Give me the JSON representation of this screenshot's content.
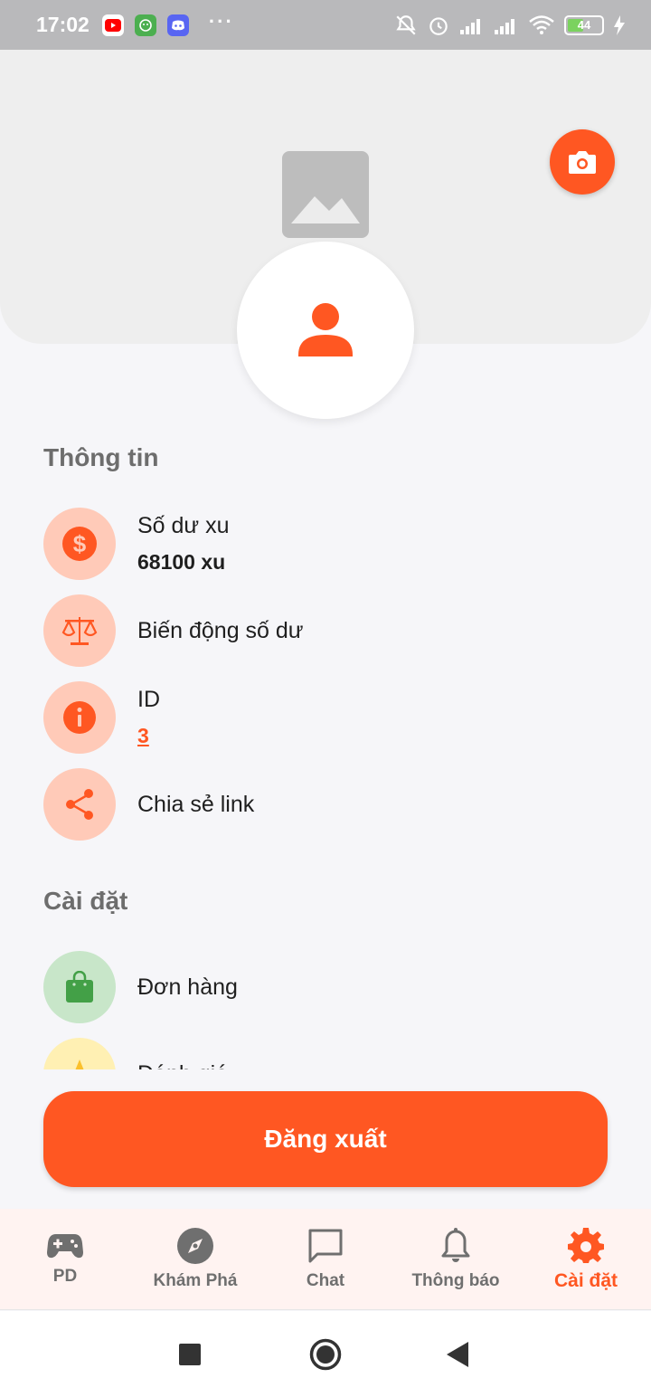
{
  "status_bar": {
    "time": "17:02",
    "battery": "44",
    "icons": [
      "youtube-icon",
      "app-icon",
      "discord-icon",
      "more-dots-icon",
      "mute-icon",
      "alarm-icon",
      "signal-icon",
      "signal-icon",
      "wifi-icon",
      "battery-icon",
      "charging-icon"
    ],
    "dots": "···"
  },
  "sections": {
    "info_title": "Thông tin",
    "settings_title": "Cài đặt"
  },
  "info_items": [
    {
      "label": "Số dư xu",
      "value": "68100 xu",
      "icon": "dollar-icon"
    },
    {
      "label": "Biến động số dư",
      "icon": "balance-scale-icon"
    },
    {
      "label": "ID",
      "value": "3",
      "icon": "info-icon"
    },
    {
      "label": "Chia sẻ link",
      "icon": "share-icon"
    }
  ],
  "settings_items": [
    {
      "label": "Đơn hàng",
      "icon": "shopping-bag-icon"
    },
    {
      "label": "Đánh giá",
      "icon": "star-icon"
    }
  ],
  "logout_label": "Đăng xuất",
  "bottom_nav": [
    {
      "label": "PD",
      "icon": "gamepad-icon"
    },
    {
      "label": "Khám Phá",
      "icon": "compass-icon"
    },
    {
      "label": "Chat",
      "icon": "chat-icon"
    },
    {
      "label": "Thông báo",
      "icon": "bell-icon"
    },
    {
      "label": "Cài đặt",
      "icon": "gear-icon",
      "active": true
    }
  ],
  "colors": {
    "accent": "#ff5722",
    "accent_light": "#ffcab8",
    "green_light": "#c8e6c9",
    "yellow_light": "#fff0b3"
  }
}
